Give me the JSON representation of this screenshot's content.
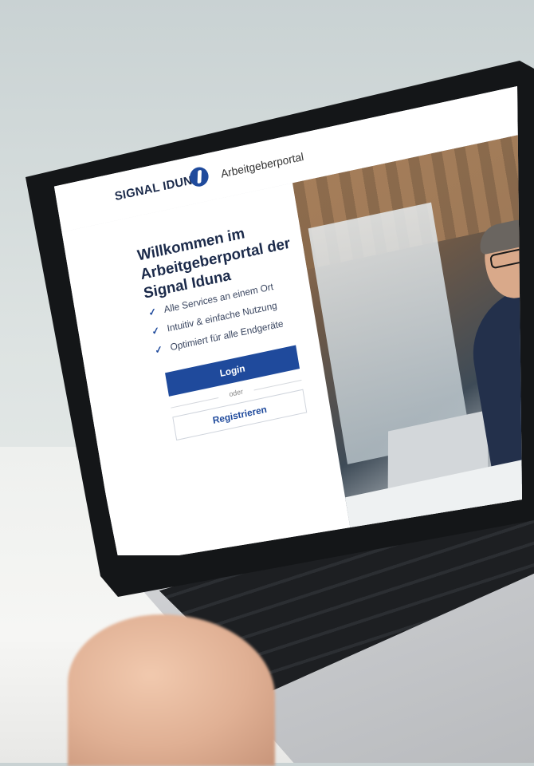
{
  "app": {
    "brand": "SIGNAL IDUNA",
    "portal_name": "Arbeitgeberportal",
    "language_flag": "de-flag"
  },
  "login": {
    "title": "Willkommen im Arbeitgeberportal der Signal Iduna",
    "features": [
      {
        "label": "Alle Services an einem Ort",
        "icon": "check-icon"
      },
      {
        "label": "Intuitiv & einfache Nutzung",
        "icon": "check-icon"
      },
      {
        "label": "Optimiert für alle Endgeräte",
        "icon": "check-icon"
      }
    ],
    "login_button": "Login",
    "separator": "oder",
    "register_button": "Registrieren"
  },
  "colors": {
    "brand_blue": "#1f4a9c",
    "text_dark": "#1b2a4a"
  }
}
